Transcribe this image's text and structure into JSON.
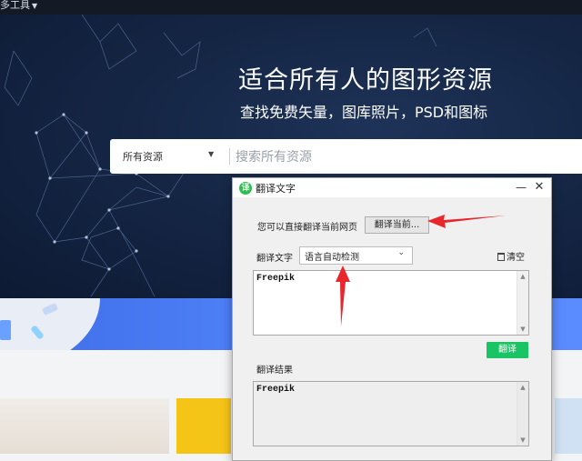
{
  "site": {
    "top_menu": "多工具",
    "hero_title": "适合所有人的图形资源",
    "hero_subtitle": "查找免费矢量，图库照片，PSD和图标",
    "search_type": "所有资源",
    "search_placeholder": "搜索所有资源"
  },
  "dialog": {
    "title": "翻译文字",
    "logo_char": "译",
    "minimize_glyph": "—",
    "close_glyph": "✕",
    "page_hint": "您可以直接翻译当前网页",
    "translate_page_button": "翻译当前...",
    "source_label": "翻译文字",
    "language_selected": "语言自动检测",
    "clear_label": "清空",
    "source_text": "Freepik",
    "translate_button": "翻译",
    "result_label": "翻译结果",
    "result_text": "Freepik"
  },
  "colors": {
    "hero_bg": "#152645",
    "accent_green": "#19c465",
    "arrow_red": "#e8262c",
    "banner_blue": "#4d7ff6"
  },
  "icons": [
    "caret-down-icon",
    "translate-logo-icon",
    "minimize-icon",
    "close-icon",
    "trash-icon",
    "chevron-down-icon",
    "arrow-icon"
  ]
}
